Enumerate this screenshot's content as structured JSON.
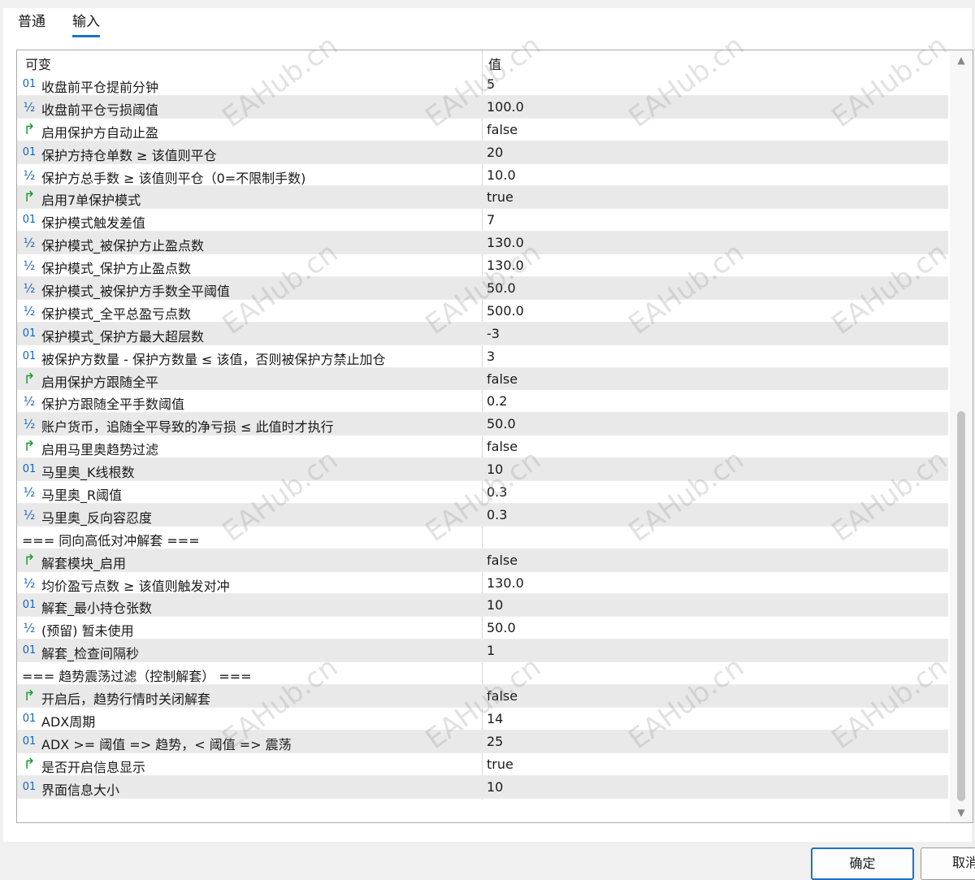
{
  "tabs": [
    {
      "label": "普通",
      "active": false
    },
    {
      "label": "输入",
      "active": true
    }
  ],
  "grid": {
    "col_variable": "可变",
    "col_value": "值",
    "rows": [
      {
        "icon": "01",
        "name": "收盘前平仓提前分钟",
        "value": "5"
      },
      {
        "icon": "½",
        "name": "收盘前平仓亏损阈值",
        "value": "100.0"
      },
      {
        "icon": "↱",
        "name": "启用保护方自动止盈",
        "value": "false"
      },
      {
        "icon": "01",
        "name": "保护方持仓单数 ≥ 该值则平仓",
        "value": "20"
      },
      {
        "icon": "½",
        "name": "保护方总手数 ≥ 该值则平仓（0=不限制手数)",
        "value": "10.0"
      },
      {
        "icon": "↱",
        "name": "启用7单保护模式",
        "value": "true"
      },
      {
        "icon": "01",
        "name": "保护模式触发差值",
        "value": "7"
      },
      {
        "icon": "½",
        "name": "保护模式_被保护方止盈点数",
        "value": "130.0"
      },
      {
        "icon": "½",
        "name": "保护模式_保护方止盈点数",
        "value": "130.0"
      },
      {
        "icon": "½",
        "name": "保护模式_被保护方手数全平阈值",
        "value": "50.0"
      },
      {
        "icon": "½",
        "name": "保护模式_全平总盈亏点数",
        "value": "500.0"
      },
      {
        "icon": "01",
        "name": "保护模式_保护方最大超层数",
        "value": "-3"
      },
      {
        "icon": "01",
        "name": "被保护方数量 - 保护方数量 ≤ 该值，否则被保护方禁止加仓",
        "value": "3"
      },
      {
        "icon": "↱",
        "name": "启用保护方跟随全平",
        "value": "false"
      },
      {
        "icon": "½",
        "name": "保护方跟随全平手数阈值",
        "value": "0.2"
      },
      {
        "icon": "½",
        "name": "账户货币，追随全平导致的净亏损 ≤ 此值时才执行",
        "value": "50.0"
      },
      {
        "icon": "↱",
        "name": "启用马里奥趋势过滤",
        "value": "false"
      },
      {
        "icon": "01",
        "name": "马里奥_K线根数",
        "value": "10"
      },
      {
        "icon": "½",
        "name": "马里奥_R阈值",
        "value": "0.3"
      },
      {
        "icon": "½",
        "name": "马里奥_反向容忍度",
        "value": "0.3"
      },
      {
        "icon": "",
        "name": "=== 同向高低对冲解套 ===",
        "value": ""
      },
      {
        "icon": "↱",
        "name": "解套模块_启用",
        "value": "false"
      },
      {
        "icon": "½",
        "name": "均价盈亏点数 ≥ 该值则触发对冲",
        "value": "130.0"
      },
      {
        "icon": "01",
        "name": "解套_最小持仓张数",
        "value": "10"
      },
      {
        "icon": "½",
        "name": "(预留) 暂未使用",
        "value": "50.0"
      },
      {
        "icon": "01",
        "name": "解套_检查间隔秒",
        "value": "1"
      },
      {
        "icon": "",
        "name": "=== 趋势震荡过滤（控制解套） ===",
        "value": ""
      },
      {
        "icon": "↱",
        "name": "开启后，趋势行情时关闭解套",
        "value": "false"
      },
      {
        "icon": "01",
        "name": "ADX周期",
        "value": "14"
      },
      {
        "icon": "01",
        "name": "ADX >= 阈值 => 趋势，< 阈值 => 震荡",
        "value": "25"
      },
      {
        "icon": "↱",
        "name": "是否开启信息显示",
        "value": "true"
      },
      {
        "icon": "01",
        "name": "界面信息大小",
        "value": "10"
      }
    ]
  },
  "buttons": {
    "ok": "确定",
    "cancel": "取消"
  },
  "watermark": "EAHub.cn",
  "colors": {
    "tab_underline": "#1b73c8",
    "bool_icon": "#1a9a2c",
    "num_icon": "#1565c0",
    "row_alt": "#e9e9e9"
  }
}
